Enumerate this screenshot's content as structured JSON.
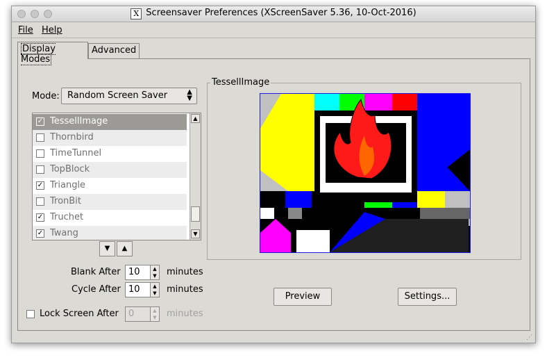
{
  "window": {
    "title": "Screensaver Preferences  (XScreenSaver 5.36, 10-Oct-2016)",
    "x_icon": "X"
  },
  "menubar": {
    "file": "File",
    "help": "Help"
  },
  "tabs": {
    "display_modes": "Display Modes",
    "advanced": "Advanced"
  },
  "mode": {
    "label": "Mode:",
    "value": "Random Screen Saver"
  },
  "list": {
    "items": [
      {
        "label": "TessellImage",
        "checked": true
      },
      {
        "label": "Thornbird",
        "checked": false
      },
      {
        "label": "TimeTunnel",
        "checked": false
      },
      {
        "label": "TopBlock",
        "checked": false
      },
      {
        "label": "Triangle",
        "checked": true
      },
      {
        "label": "TronBit",
        "checked": false
      },
      {
        "label": "Truchet",
        "checked": true
      },
      {
        "label": "Twang",
        "checked": true
      }
    ]
  },
  "blank_after": {
    "label": "Blank After",
    "value": "10",
    "unit": "minutes"
  },
  "cycle_after": {
    "label": "Cycle After",
    "value": "10",
    "unit": "minutes"
  },
  "lock_screen": {
    "label": "Lock Screen After",
    "value": "0",
    "unit": "minutes",
    "checked": false
  },
  "preview_group": {
    "label": "TessellImage"
  },
  "buttons": {
    "preview": "Preview",
    "settings": "Settings..."
  },
  "colors": {
    "selection": "#9c9a96",
    "window_bg": "#dcdad5",
    "preview_border": "#1b1be0"
  }
}
